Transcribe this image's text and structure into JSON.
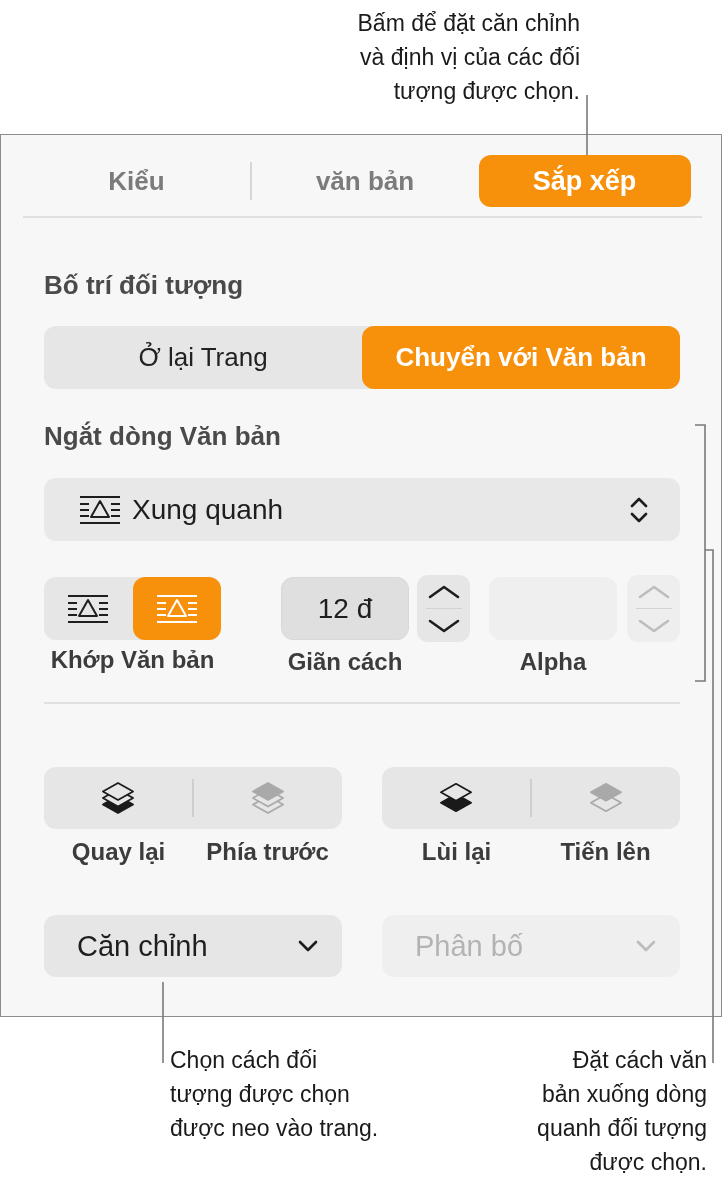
{
  "callouts": {
    "top": "Bấm để đặt căn chỉnh\nvà định vị của các đối\ntượng được chọn.",
    "bottom_left": "Chọn cách đối\ntượng được chọn\nđược neo vào trang.",
    "bottom_right": "Đặt cách văn\nbản xuống dòng\nquanh đối tượng\nđược chọn."
  },
  "tabs": [
    {
      "label": "Kiểu",
      "selected": false
    },
    {
      "label": "văn bản",
      "selected": false
    },
    {
      "label": "Sắp xếp",
      "selected": true
    }
  ],
  "object_placement": {
    "heading": "Bố trí đối tượng",
    "options": [
      {
        "label": "Ở lại Trang",
        "selected": false
      },
      {
        "label": "Chuyển với Văn bản",
        "selected": true
      }
    ]
  },
  "text_wrap": {
    "heading": "Ngắt dòng Văn bản",
    "dropdown": {
      "value": "Xung quanh"
    },
    "fit": {
      "label": "Khớp Văn bản",
      "options": [
        {
          "selected": false
        },
        {
          "selected": true
        }
      ]
    },
    "spacing": {
      "label": "Giãn cách",
      "value": "12 đ",
      "disabled": false
    },
    "alpha": {
      "label": "Alpha",
      "disabled": true
    }
  },
  "layer_groups": [
    {
      "buttons": [
        {
          "kind": "back",
          "label": "Quay lại",
          "disabled": false
        },
        {
          "kind": "front",
          "label": "Phía trước",
          "disabled": true
        }
      ]
    },
    {
      "buttons": [
        {
          "kind": "backward",
          "label": "Lùi lại",
          "disabled": false
        },
        {
          "kind": "forward",
          "label": "Tiến lên",
          "disabled": true
        }
      ]
    }
  ],
  "menus": [
    {
      "label": "Căn chỉnh",
      "disabled": false
    },
    {
      "label": "Phân bố",
      "disabled": true
    }
  ]
}
